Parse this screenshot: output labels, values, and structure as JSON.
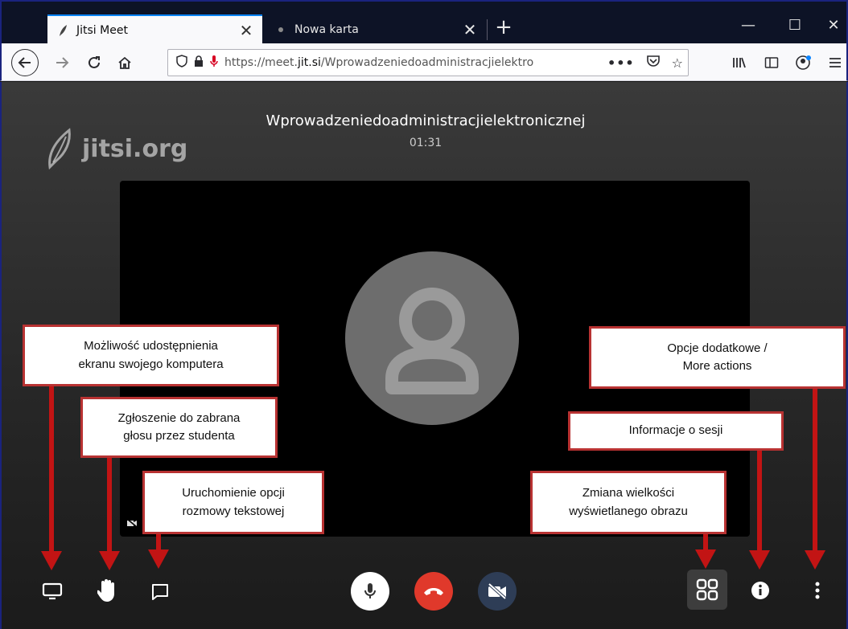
{
  "browser": {
    "tabs": [
      {
        "label": "Jitsi Meet",
        "active": true
      },
      {
        "label": "Nowa karta",
        "active": false
      }
    ],
    "url_scheme_host": "https://meet.",
    "url_host_bold": "jit.si",
    "url_path": "/Wprowadzeniedoadministracjielektro"
  },
  "meeting": {
    "watermark": "jitsi.org",
    "title": "Wprowadzeniedoadministracjielektronicznej",
    "timer": "01:31"
  },
  "callouts": {
    "screen_share": "Możliwość udostępnienia\nekranu swojego komputera",
    "raise_hand": "Zgłoszenie do zabrana\ngłosu przez studenta",
    "chat": "Uruchomienie opcji\nrozmowy tekstowej",
    "tile_view": "Zmiana wielkości\nwyświetlanego obrazu",
    "info": "Informacje o sesji",
    "more": "Opcje dodatkowe /\nMore actions"
  },
  "colors": {
    "hangup": "#e0392b",
    "annotation": "#c21414",
    "tab_accent": "#0a84ff"
  }
}
